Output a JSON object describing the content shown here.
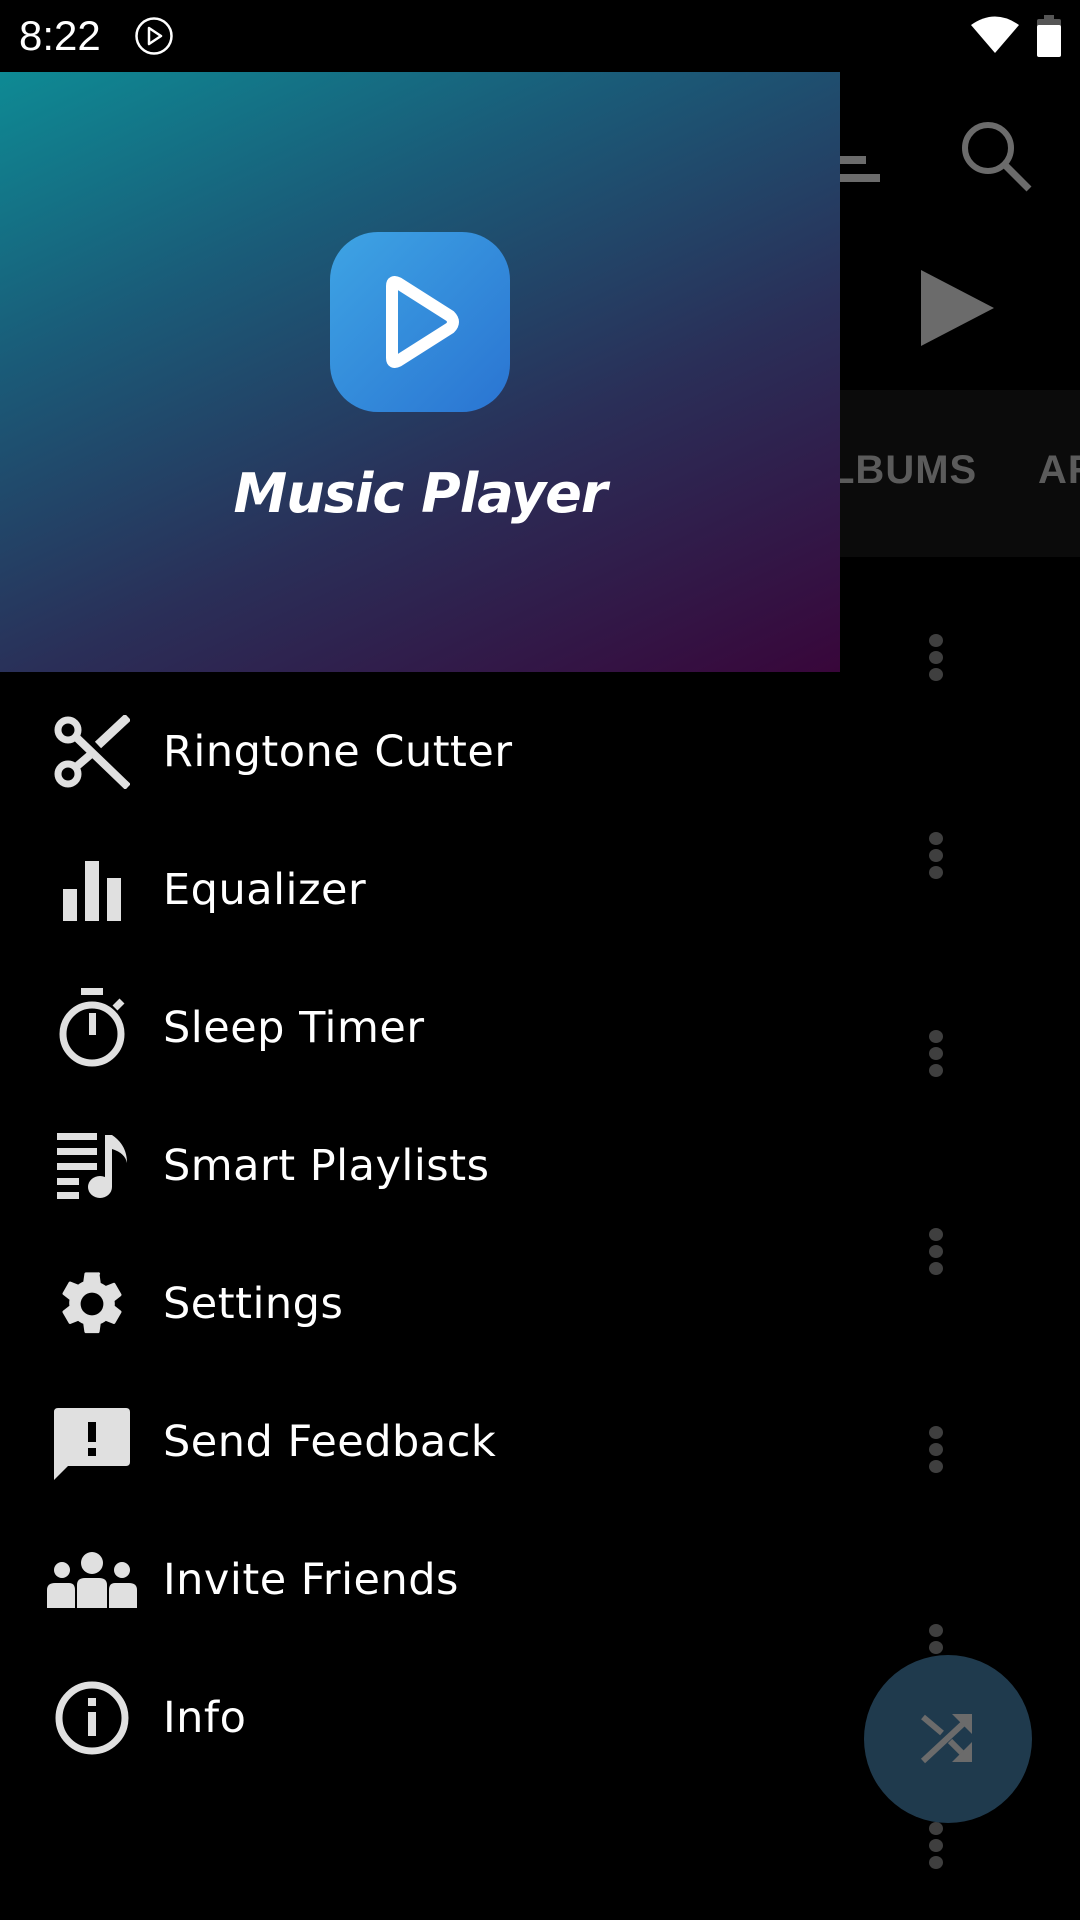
{
  "status_bar": {
    "time": "8:22",
    "icons": [
      "media-play-icon",
      "wifi-icon",
      "battery-icon"
    ]
  },
  "background_app": {
    "toolbar_icons": [
      "sort-icon",
      "search-icon"
    ],
    "play_icon": "play-icon",
    "tabs": [
      {
        "label": "LBUMS",
        "full_label": "ALBUMS"
      },
      {
        "label": "AR"
      }
    ],
    "list_row_menu_count": 8,
    "fab_icon": "shuffle-icon",
    "colors": {
      "fab": "#1f3a4d",
      "tab_bar": "#0b0b0b",
      "tab_text": "#5b5b5b"
    }
  },
  "drawer": {
    "header": {
      "app_name": "Music Player",
      "logo_icon": "play-icon",
      "gradient": [
        "#0e8a94",
        "#2a2f58",
        "#38063a"
      ],
      "logo_colors": [
        "#3ea4e4",
        "#2a74d2"
      ]
    },
    "items": [
      {
        "label": "Ringtone Cutter",
        "icon": "scissors-icon"
      },
      {
        "label": "Equalizer",
        "icon": "equalizer-icon"
      },
      {
        "label": "Sleep Timer",
        "icon": "timer-icon"
      },
      {
        "label": "Smart Playlists",
        "icon": "playlist-music-icon"
      },
      {
        "label": "Settings",
        "icon": "gear-icon"
      },
      {
        "label": "Send Feedback",
        "icon": "feedback-icon"
      },
      {
        "label": "Invite Friends",
        "icon": "group-icon"
      },
      {
        "label": "Info",
        "icon": "info-icon"
      }
    ],
    "icon_color": "#e0e0e0"
  }
}
